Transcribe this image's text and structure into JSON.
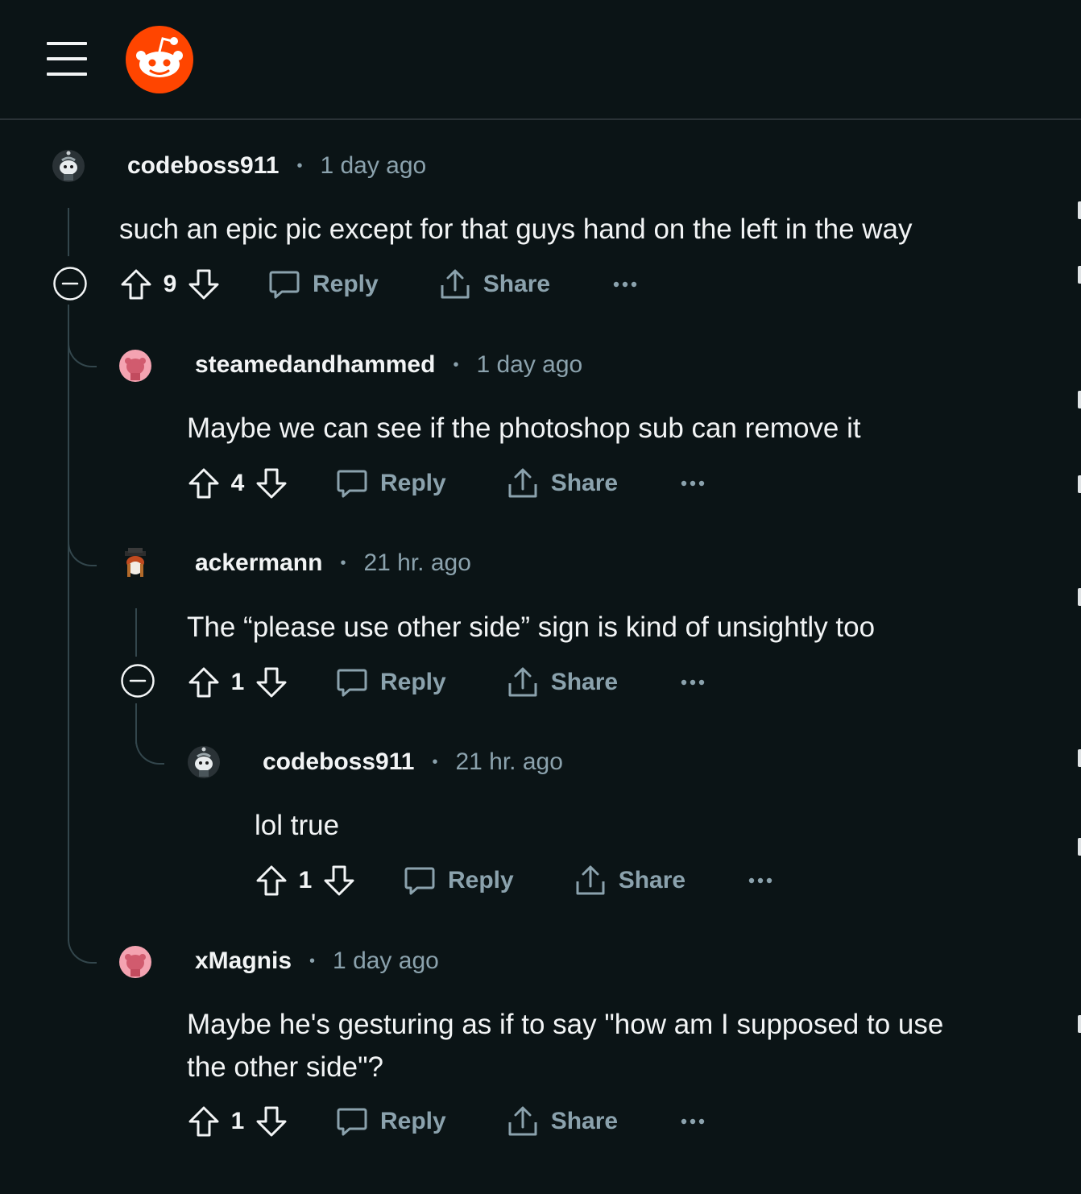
{
  "header": {
    "menu_icon": "hamburger-menu-icon",
    "logo_icon": "reddit-logo-icon",
    "brand_color": "#ff4500"
  },
  "labels": {
    "reply": "Reply",
    "share": "Share",
    "separator": "•"
  },
  "comments": [
    {
      "author": "codeboss911",
      "time": "1 day ago",
      "body": "such an epic pic except for that guys hand on the left in the way",
      "score": "9",
      "avatar": "snoo-gray-avatar"
    },
    {
      "author": "steamedandhammed",
      "time": "1 day ago",
      "body": "Maybe we can see if the photoshop sub can remove it",
      "score": "4",
      "avatar": "snoo-pink-avatar"
    },
    {
      "author": "ackermann",
      "time": "21 hr. ago",
      "body": "The “please use other side” sign is kind of unsightly too",
      "score": "1",
      "avatar": "snoo-hat-avatar"
    },
    {
      "author": "codeboss911",
      "time": "21 hr. ago",
      "body": "lol true",
      "score": "1",
      "avatar": "snoo-gray-avatar"
    },
    {
      "author": "xMagnis",
      "time": "1 day ago",
      "body_line1": "Maybe he's gesturing as if to say \"how am I supposed to use",
      "body_line2": "the other side\"?",
      "score": "1",
      "avatar": "snoo-pink-avatar"
    }
  ]
}
